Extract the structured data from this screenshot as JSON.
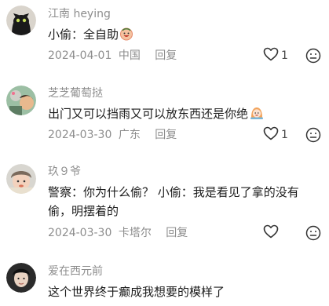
{
  "comments": [
    {
      "author": "江南 heying",
      "text": "小偷：全自助",
      "emoji": "grinning-face-emoji",
      "date": "2024-04-01",
      "location": "中国",
      "reply_label": "回复",
      "likes": "1"
    },
    {
      "author": "芝芝葡萄挞",
      "text": "出门又可以挡雨又可以放东西还是你绝",
      "emoji": "baby-face-emoji",
      "date": "2024-03-30",
      "location": "广东",
      "reply_label": "回复",
      "likes": "1"
    },
    {
      "author": "玖９爷",
      "text_line1": "警察：你为什么偷？  小偷：我是看见了拿的没有",
      "text_line2": "偷，明摆着的",
      "date": "2024-03-30",
      "location": "卡塔尔",
      "reply_label": "回复"
    },
    {
      "author": "爱在西元前",
      "text": "这个世界终于癫成我想要的模样了"
    }
  ],
  "icons": {
    "like": "heart-outline-icon",
    "dislike": "neutral-face-outline-icon"
  },
  "colors": {
    "meta_text": "#8d8d8d",
    "body_text": "#1c1c1c",
    "icon_stroke": "#333333"
  }
}
